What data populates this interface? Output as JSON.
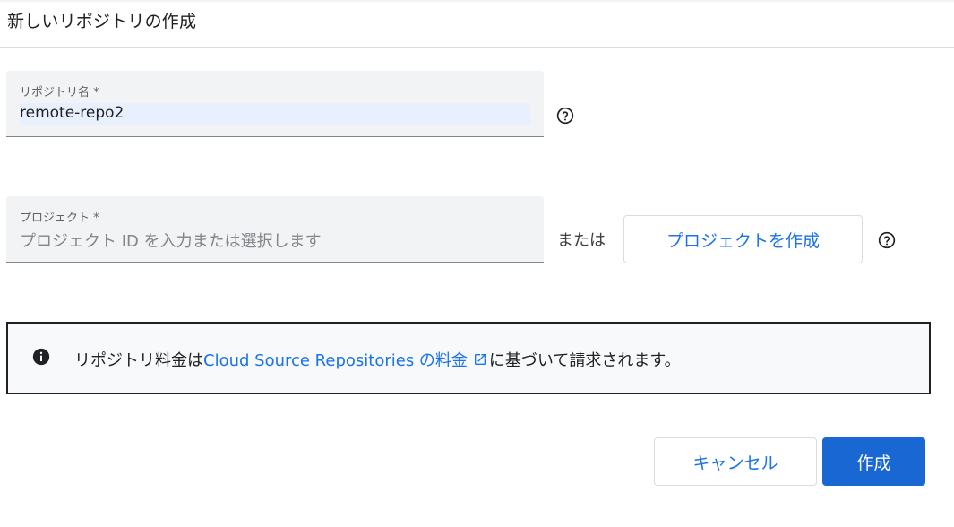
{
  "dialog": {
    "title": "新しいリポジトリの作成"
  },
  "repo_name_field": {
    "label": "リポジトリ名 *",
    "value": "remote-repo2"
  },
  "project_field": {
    "label": "プロジェクト *",
    "placeholder": "プロジェクト ID を入力または選択します"
  },
  "or_text": "または",
  "create_project_button": "プロジェクトを作成",
  "info": {
    "prefix": "リポジトリ料金は ",
    "link_text": "Cloud Source Repositories の料金",
    "suffix": "に基づいて請求されます。"
  },
  "actions": {
    "cancel": "キャンセル",
    "create": "作成"
  },
  "colors": {
    "accent": "#1a73e8",
    "primary_button": "#1967d2",
    "field_background": "#f1f3f4",
    "autofill_highlight": "#e8f0fe"
  },
  "icons": [
    "help-icon",
    "info-icon",
    "external-link-icon"
  ]
}
